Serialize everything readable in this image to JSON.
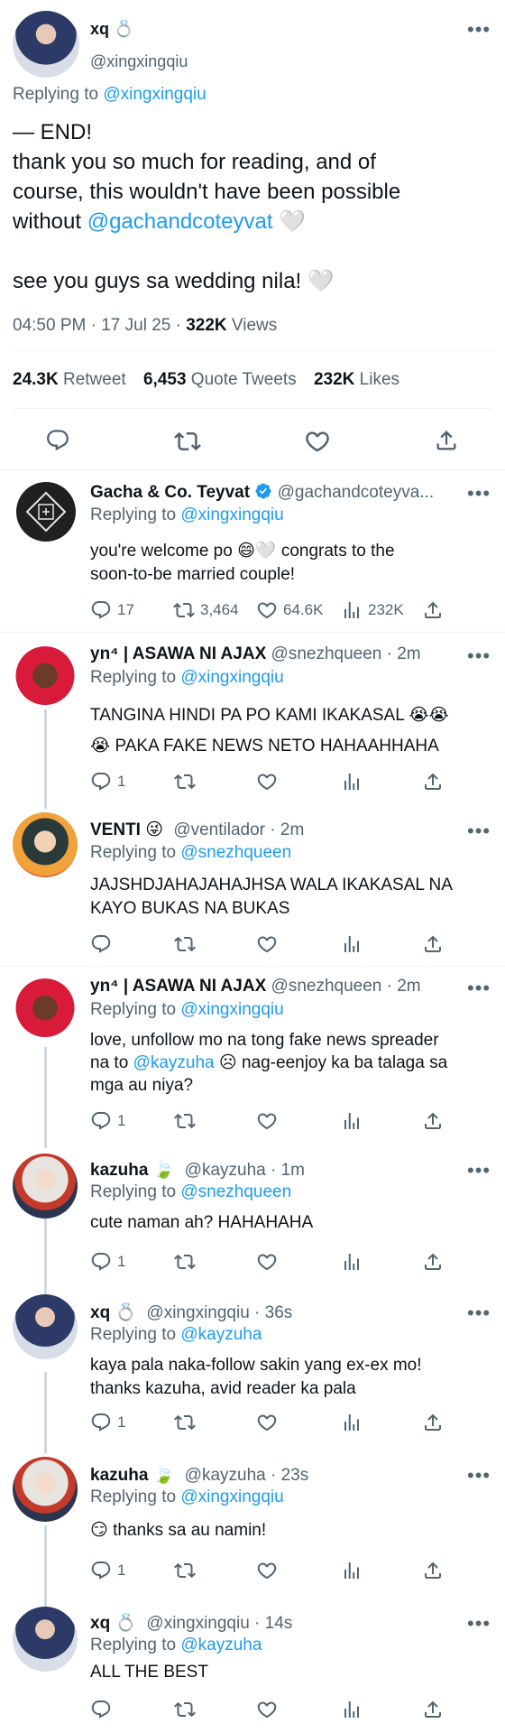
{
  "main_tweet": {
    "name": "xq",
    "name_emoji": "💍",
    "handle": "@xingxingqiu",
    "reply_prefix": "Replying to",
    "reply_to": "@xingxingqiu",
    "line1": "— END!",
    "line2": "thank you so much for reading, and of",
    "line3": "course, this wouldn't have been possible",
    "line4_prefix": "without",
    "line4_mention": "@gachandcoteyvat",
    "line4_emoji": "🤍",
    "line5": "see you guys sa wedding nila! 🤍",
    "timestamp": "04:50 PM · 17 Jul 25 ·",
    "views_value": "322K",
    "views_label": "Views",
    "retweets_value": "24.3K",
    "retweets_label": "Retweet",
    "quotes_value": "6,453",
    "quotes_label": "Quote Tweets",
    "likes_value": "232K",
    "likes_label": "Likes"
  },
  "replies": [
    {
      "name": "Gacha & Co. Teyvat",
      "handle_time": "@gachandcoteyva...",
      "reply_prefix": "Replying to",
      "reply_to": "@xingxingqiu",
      "text1": "you're welcome po 😄🤍  congrats to the",
      "text2": "soon-to-be married couple!",
      "reply_count": "17",
      "retweet_count": "3,464",
      "like_count": "64.6K",
      "views_count": "232K"
    },
    {
      "name": "yn⁴ | ASAWA NI AJAX",
      "handle_time": "@snezhqueen · 2m",
      "reply_prefix": "Replying to",
      "reply_to": "@xingxingqiu",
      "text1": "TANGINA HINDI PA PO KAMI IKAKASAL 😭😭",
      "text2": "😭  PAKA FAKE NEWS NETO HAHAAHHAHA",
      "reply_count": "1"
    },
    {
      "name": "VENTI",
      "name_emoji": "😜",
      "handle_time": "@ventilador · 2m",
      "reply_prefix": "Replying to",
      "reply_to": "@snezhqueen",
      "text1": "JAJSHDJAHAJAHAJHSA WALA IKAKASAL NA",
      "text2": "KAYO BUKAS NA BUKAS"
    },
    {
      "name": "yn⁴ | ASAWA NI AJAX",
      "handle_time": "@snezhqueen · 2m",
      "reply_prefix": "Replying to",
      "reply_to": "@xingxingqiu",
      "text1": "love, unfollow mo na tong fake news spreader",
      "text2_prefix": "na to",
      "text2_mention": "@kayzuha",
      "text2_suffix": "☹ nag-eenjoy ka ba talaga sa",
      "text3": "mga au niya?",
      "reply_count": "1"
    },
    {
      "name": "kazuha",
      "name_emoji": "🍃",
      "handle_time": "@kayzuha · 1m",
      "reply_prefix": "Replying to",
      "reply_to": "@snezhqueen",
      "text1": "cute naman ah? HAHAHAHA",
      "reply_count": "1"
    },
    {
      "name": "xq",
      "name_emoji": "💍",
      "handle_time": "@xingxingqiu · 36s",
      "reply_prefix": "Replying to",
      "reply_to": "@kayzuha",
      "text1": "kaya pala naka-follow sakin yang ex-ex mo!",
      "text2": "thanks kazuha, avid reader ka pala",
      "reply_count": "1"
    },
    {
      "name": "kazuha",
      "name_emoji": "🍃",
      "handle_time": "@kayzuha · 23s",
      "reply_prefix": "Replying to",
      "reply_to": "@xingxingqiu",
      "text1": "😏  thanks sa au namin!",
      "reply_count": "1"
    },
    {
      "name": "xq",
      "name_emoji": "💍",
      "handle_time": "@xingxingqiu · 14s",
      "reply_prefix": "Replying to",
      "reply_to": "@kayzuha",
      "text1": "ALL THE BEST"
    }
  ],
  "icons": {
    "more": "more-dots-icon",
    "reply": "reply-icon",
    "retweet": "retweet-icon",
    "like": "heart-icon",
    "views": "views-icon",
    "share": "share-icon",
    "verified": "verified-badge-icon"
  },
  "colors": {
    "link": "#1d9bf0",
    "muted": "#536471",
    "verified": "#1d9bf0",
    "heart_avatar": "#d81b3a"
  }
}
